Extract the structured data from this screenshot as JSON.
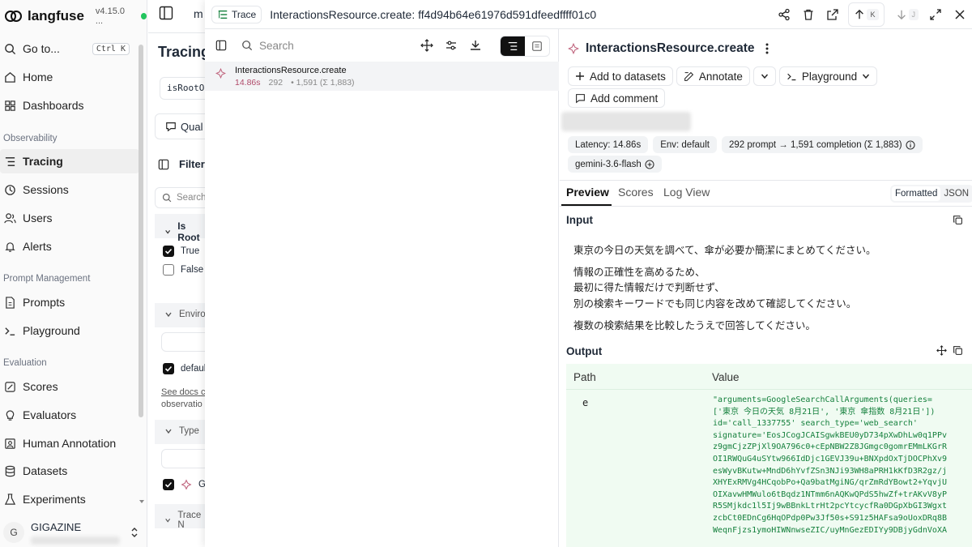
{
  "app": {
    "name": "langfuse",
    "version": "v4.15.0 ..."
  },
  "sidebar": {
    "goto": {
      "label": "Go to...",
      "shortcut": "Ctrl K"
    },
    "items_main": [
      {
        "label": "Home",
        "icon": "home-icon"
      },
      {
        "label": "Dashboards",
        "icon": "dashboard-icon"
      }
    ],
    "sections": [
      {
        "title": "Observability",
        "items": [
          {
            "label": "Tracing",
            "icon": "tracing-icon",
            "active": true
          },
          {
            "label": "Sessions",
            "icon": "clock-icon"
          },
          {
            "label": "Users",
            "icon": "users-icon"
          },
          {
            "label": "Alerts",
            "icon": "bell-icon"
          }
        ]
      },
      {
        "title": "Prompt Management",
        "items": [
          {
            "label": "Prompts",
            "icon": "file-icon"
          },
          {
            "label": "Playground",
            "icon": "terminal-icon"
          }
        ]
      },
      {
        "title": "Evaluation",
        "items": [
          {
            "label": "Scores",
            "icon": "scores-icon"
          },
          {
            "label": "Evaluators",
            "icon": "lightbulb-icon"
          },
          {
            "label": "Human Annotation",
            "icon": "annotation-icon"
          },
          {
            "label": "Datasets",
            "icon": "database-icon"
          },
          {
            "label": "Experiments",
            "icon": "flask-icon"
          }
        ]
      }
    ],
    "user": {
      "initial": "G",
      "org": "GIGAZINE"
    }
  },
  "under": {
    "header_fragment": "m",
    "title": "Tracing",
    "chip": "isRootOb",
    "quality_btn": "Qual",
    "filters": "Filter",
    "search_placeholder": "Search",
    "is_root": "Is Root",
    "opt_true": "True",
    "opt_false": "False",
    "environment": "Enviro",
    "env_default": "defaul",
    "see_docs": "See docs",
    "see_docs_rest": "c",
    "observation": "observatio",
    "type": "Type",
    "gen_letter": "G",
    "trace_name": "Trace N"
  },
  "topbar": {
    "badge": "Trace",
    "title": "InteractionsResource.create: ff4d94b64e61976d591dfeedffff01c0",
    "key_up": "K",
    "key_down": "J"
  },
  "leftpane": {
    "search_placeholder": "Search",
    "row": {
      "name": "InteractionsResource.create",
      "latency": "14.86s",
      "prompt": "292",
      "rest": "• 1,591 (Σ 1,883)"
    }
  },
  "detail": {
    "title": "InteractionsResource.create",
    "buttons": {
      "add_to_datasets": "Add to datasets",
      "annotate": "Annotate",
      "playground": "Playground",
      "add_comment": "Add comment"
    },
    "pills": {
      "latency": "Latency: 14.86s",
      "env": "Env: default",
      "tokens": "292 prompt → 1,591 completion (Σ 1,883)",
      "model": "gemini-3.6-flash"
    },
    "tabs": {
      "preview": "Preview",
      "scores": "Scores",
      "log_view": "Log View",
      "formatted": "Formatted",
      "json": "JSON"
    },
    "input_label": "Input",
    "input_lines": [
      "東京の今日の天気を調べて、傘が必要か簡潔にまとめてください。",
      "情報の正確性を高めるため、",
      "最初に得た情報だけで判断せず、",
      "別の検索キーワードでも同じ内容を改めて確認してください。",
      "複数の検索結果を比較したうえで回答してください。"
    ],
    "output_label": "Output",
    "table": {
      "headers": [
        "Path",
        "Value"
      ],
      "path": "e",
      "value_lines": [
        "\"arguments=GoogleSearchCallArguments(queries=",
        "['東京 今日の天気 8月21日', '東京 傘指数 8月21日'])",
        "id='call_1337755' search_type='web_search'",
        "signature='EosJCogJCAISgwkBEU0yD734pXwDhLw0q1PPv",
        "z9gmCjzZPjXl9OA796c0+cEpNBW2Z8JGmgc0gomrEMmLKGrR",
        "OI1RWQuG4uSYtw966IdDjc1GEVJ39u+BNXpdOxTjDOCPhXv9",
        "esWyvBKutw+MndD6hYvfZSn3NJi93WH8aPRH1kKfD3R2gz/j",
        "XHYExRMVg4HCqobPo+Qa9batMgiNG/qrZmRdYBowt2+YqvjU",
        "OIXavwHMWulo6tBqdz1NTmm6nAQKwQPdS5hwZf+trAKvV8yP",
        "R5SMjkdc1l5Ij9wBBnkLtrHt2pcYtcycfRa0DGpXbGI3Wgxt",
        "zcbCt0EDnCg6HqOPdp0Pw3Jf50s+S91z5HAFsa9oUoxDRq8B",
        "WeqnFjzs1ymoHIWNnwseZIC/uyMnGezEDIYy9DBjyGdnVoXA"
      ]
    }
  }
}
